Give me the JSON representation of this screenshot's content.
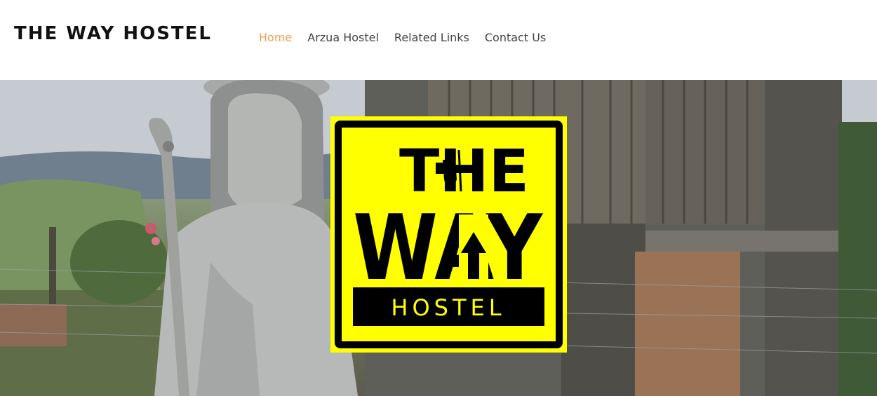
{
  "header": {
    "site_title": "THE WAY HOSTEL",
    "nav": [
      {
        "label": "Home",
        "active": true
      },
      {
        "label": "Arzua Hostel",
        "active": false
      },
      {
        "label": "Related Links",
        "active": false
      },
      {
        "label": "Contact Us",
        "active": false
      }
    ]
  },
  "hero": {
    "logo": {
      "line1": "THE",
      "line2": "WAY",
      "line3": "HOSTEL",
      "background_color": "#ffff00",
      "ink_color": "#000000"
    }
  },
  "colors": {
    "nav_active": "#f0a04b",
    "nav_default": "#444444",
    "title": "#111111"
  }
}
